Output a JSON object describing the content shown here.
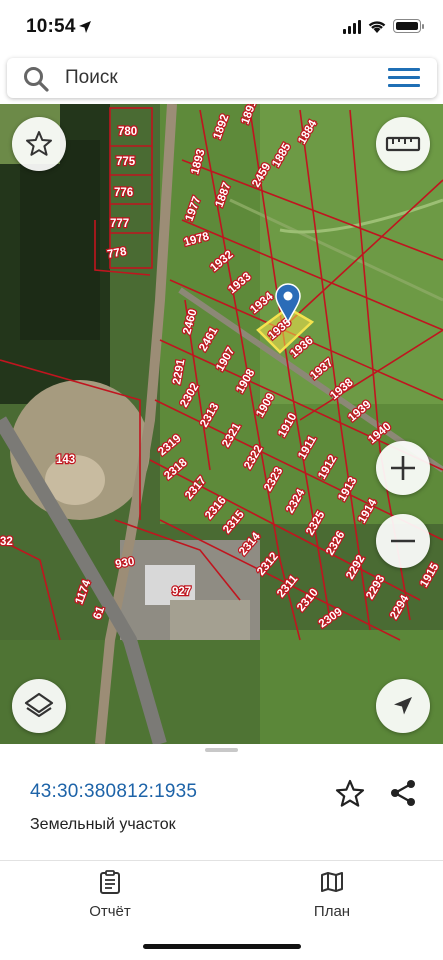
{
  "status_bar": {
    "time": "10:54",
    "battery_level": 0.9
  },
  "search": {
    "placeholder": "Поиск"
  },
  "map": {
    "plot_labels": {
      "p780": "780",
      "p775": "775",
      "p776": "776",
      "p777": "777",
      "p778": "778",
      "p1892": "1892",
      "p1891": "1891",
      "p1893": "1893",
      "p1884": "1884",
      "p1885": "1885",
      "p2459": "2459",
      "p1887": "1887",
      "p1977": "1977",
      "p1978": "1978",
      "p1932": "1932",
      "p1933": "1933",
      "p1934": "1934",
      "p1935": "1935",
      "p2460": "2460",
      "p2461": "2461",
      "p1907": "1907",
      "p1936": "1936",
      "p1937": "1937",
      "p1938": "1938",
      "p1939": "1939",
      "p1940": "1940",
      "p2291": "2291",
      "p2302": "2302",
      "p1908": "1908",
      "p2313": "2313",
      "p1909": "1909",
      "p2321": "2321",
      "p1910": "1910",
      "p2322": "2322",
      "p1911": "1911",
      "p2319": "2319",
      "p2318": "2318",
      "p2323": "2323",
      "p1912": "1912",
      "p2317": "2317",
      "p2324": "2324",
      "p1913": "1913",
      "p2316": "2316",
      "p2325": "2325",
      "p1914": "1914",
      "p2315": "2315",
      "p2326": "2326",
      "p2314": "2314",
      "p2292": "2292",
      "p2312": "2312",
      "p2293": "2293",
      "p2311": "2311",
      "p2294": "2294",
      "p2310": "2310",
      "p2309": "2309",
      "p143": "143",
      "p32": "32",
      "p930": "930",
      "p927": "927",
      "p1174": "1174",
      "p61": "61",
      "p1915": "1915"
    }
  },
  "parcel": {
    "cadastral_number": "43:30:380812:1935",
    "type": "Земельный участок"
  },
  "tabs": {
    "report": "Отчёт",
    "plan": "План"
  },
  "colors": {
    "accent": "#1d63a8",
    "boundary": "#c0151f",
    "selected": "#f2e24a"
  }
}
